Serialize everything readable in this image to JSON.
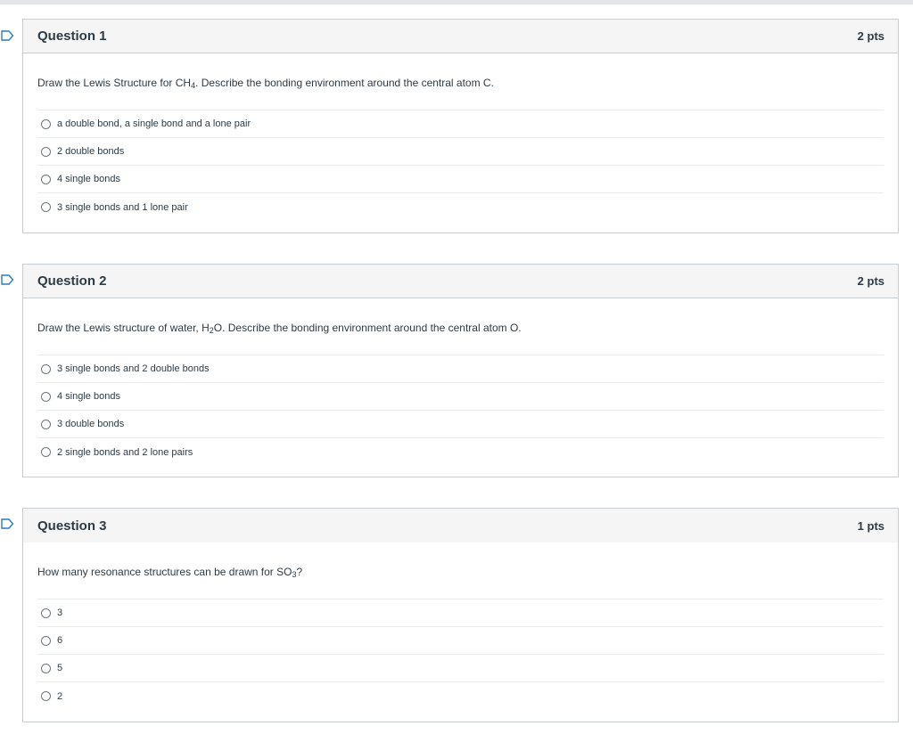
{
  "questions": [
    {
      "title": "Question 1",
      "points": "2 pts",
      "prompt_before": "Draw the Lewis Structure for CH",
      "prompt_sub": "4",
      "prompt_after": ". Describe the bonding environment around the central atom C.",
      "answers": [
        "a double bond, a single bond and a lone pair",
        "2 double bonds",
        "4 single bonds",
        "3 single bonds and 1 lone pair"
      ]
    },
    {
      "title": "Question 2",
      "points": "2 pts",
      "prompt_before": "Draw the Lewis structure of water, H",
      "prompt_sub": "2",
      "prompt_after": "O. Describe the bonding environment around the central atom O.",
      "answers": [
        "3 single bonds and 2 double bonds",
        "4 single bonds",
        "3 double bonds",
        "2 single bonds and 2 lone pairs"
      ]
    },
    {
      "title": "Question 3",
      "points": "1 pts",
      "prompt_before": "How many resonance structures can be drawn for SO",
      "prompt_sub": "3",
      "prompt_after": "?",
      "answers": [
        "3",
        "6",
        "5",
        "2"
      ]
    }
  ],
  "colors": {
    "flag": "#2d7cc1",
    "border": "#c7cdd1",
    "header_bg": "#f5f5f5",
    "text": "#2d3b45"
  },
  "icons": {
    "flag": "bookmark-flag-icon",
    "radio": "radio-button-icon"
  }
}
